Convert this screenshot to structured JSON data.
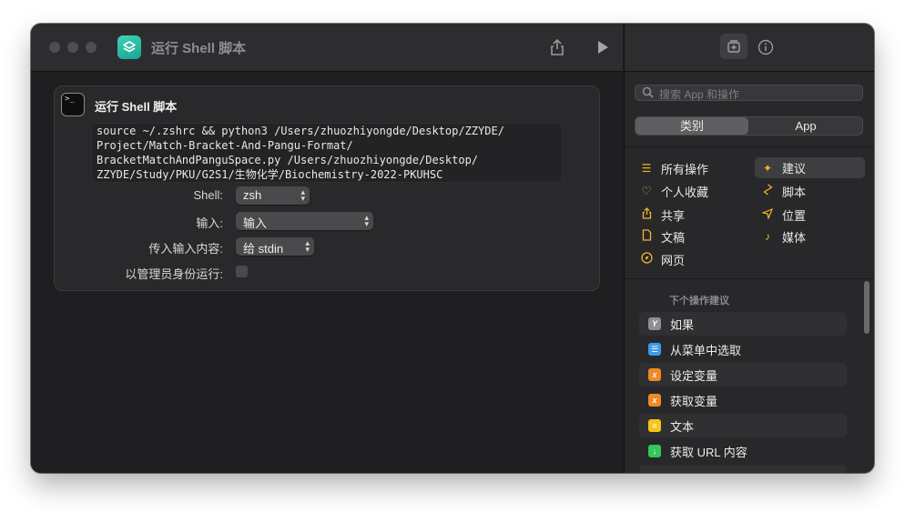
{
  "window": {
    "title": "运行 Shell 脚本"
  },
  "action": {
    "title": "运行 Shell 脚本",
    "script_lines": [
      "source ~/.zshrc && python3 /Users/zhuozhiyongde/Desktop/ZZYDE/",
      "Project/Match-Bracket-And-Pangu-Format/",
      "BracketMatchAndPanguSpace.py /Users/zhuozhiyongde/Desktop/",
      "ZZYDE/Study/PKU/G2S1/生物化学/Biochemistry-2022-PKUHSC"
    ],
    "params": {
      "shell_label": "Shell:",
      "shell_value": "zsh",
      "input_label": "输入:",
      "input_value": "输入",
      "pass_label": "传入输入内容:",
      "pass_value": "给 stdin",
      "admin_label": "以管理员身份运行:",
      "admin_checked": false
    }
  },
  "sidebar": {
    "search_placeholder": "搜索 App 和操作",
    "segments": [
      "类别",
      "App"
    ],
    "active_segment": 0,
    "categories_left": [
      "所有操作",
      "个人收藏",
      "共享",
      "文稿",
      "网页"
    ],
    "categories_right": [
      "建议",
      "脚本",
      "位置",
      "媒体"
    ],
    "active_category": "建议",
    "next_actions_heading": "下个操作建议",
    "next_actions": [
      {
        "label": "如果",
        "icon": "if-icon",
        "color": "#8e8e93"
      },
      {
        "label": "从菜单中选取",
        "icon": "menu-icon",
        "color": "#3d9be9"
      },
      {
        "label": "设定变量",
        "icon": "variable-icon",
        "color": "#f08a24"
      },
      {
        "label": "获取变量",
        "icon": "variable-icon",
        "color": "#f08a24"
      },
      {
        "label": "文本",
        "icon": "text-icon",
        "color": "#f5c518"
      },
      {
        "label": "获取 URL 内容",
        "icon": "url-content-icon",
        "color": "#34c759"
      }
    ]
  }
}
